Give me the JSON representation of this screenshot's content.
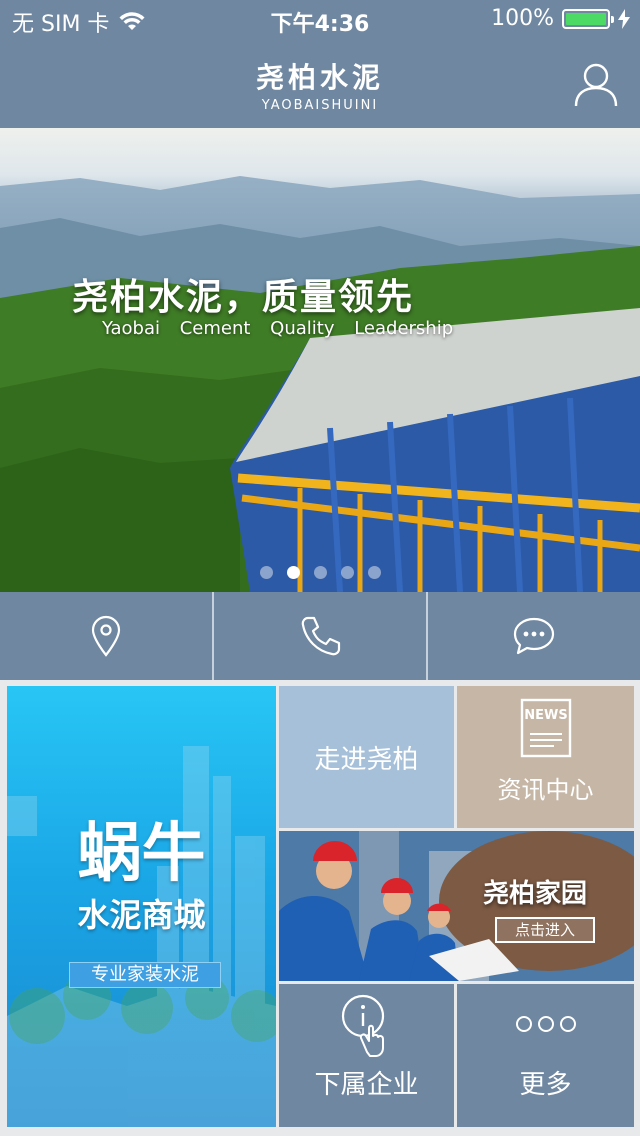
{
  "status_bar": {
    "carrier": "无 SIM 卡",
    "time": "下午4:36",
    "battery_percent": "100%",
    "battery_level": 1.0
  },
  "header": {
    "logo_cn": "尧柏水泥",
    "logo_en": "YAOBAISHUINI",
    "user_icon": "user-icon"
  },
  "banner": {
    "title": "尧柏水泥，质量领先",
    "subtitle": "Yaobai Cement Quality Leadership",
    "slide_count": 5,
    "active_slide": 2
  },
  "actions": [
    {
      "icon": "location-pin-icon"
    },
    {
      "icon": "phone-icon"
    },
    {
      "icon": "chat-bubble-icon"
    }
  ],
  "tiles": {
    "mall": {
      "title": "蜗牛",
      "subtitle": "水泥商城",
      "tag": "专业家装水泥"
    },
    "about": {
      "label": "走进尧柏"
    },
    "news": {
      "label": "资讯中心",
      "icon_text": "NEWS"
    },
    "home": {
      "label": "尧柏家园",
      "button": "点击进入"
    },
    "subsidiaries": {
      "label": "下属企业"
    },
    "more": {
      "label": "更多"
    }
  },
  "colors": {
    "bar": "#6f87a0",
    "about_tile": "#a6c0d9",
    "news_tile": "#c6b6a6",
    "mall_tile": "#1aa6e6",
    "battery": "#4cd964"
  }
}
